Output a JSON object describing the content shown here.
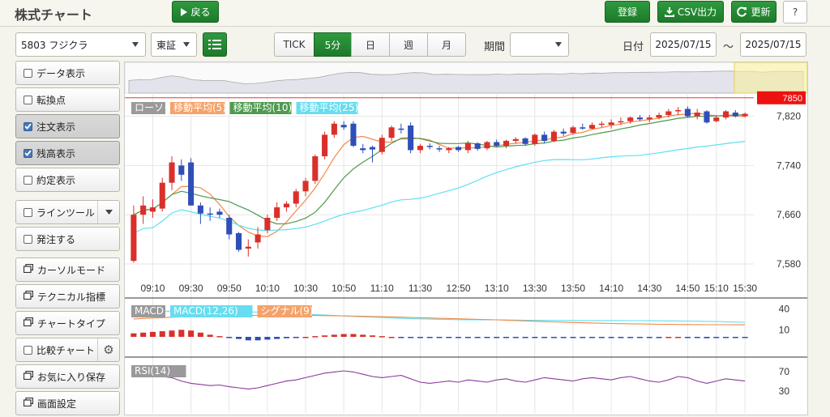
{
  "header": {
    "title": "株式チャート",
    "back_label": "戻る",
    "register_label": "登録",
    "csv_label": "CSV出力",
    "refresh_label": "更新",
    "help_label": "?"
  },
  "toolbar": {
    "stock": "5803 フジクラ",
    "market": "東証",
    "ranges": [
      "TICK",
      "5分",
      "日",
      "週",
      "月"
    ],
    "active_range": "5分",
    "period_label": "期間",
    "period_value": "",
    "date_label": "日付",
    "date_from": "2025/07/15",
    "date_sep": "～",
    "date_to": "2025/07/15"
  },
  "sidebar": {
    "items": [
      {
        "label": "データ表示",
        "type": "check",
        "checked": false
      },
      {
        "label": "転換点",
        "type": "check",
        "checked": false
      },
      {
        "label": "注文表示",
        "type": "check",
        "checked": true
      },
      {
        "label": "残高表示",
        "type": "check",
        "checked": true
      },
      {
        "label": "約定表示",
        "type": "check",
        "checked": false
      },
      {
        "label": "ラインツール",
        "type": "check-dropdown",
        "checked": false
      },
      {
        "label": "発注する",
        "type": "check",
        "checked": false
      },
      {
        "label": "カーソルモード",
        "type": "window"
      },
      {
        "label": "テクニカル指標",
        "type": "window"
      },
      {
        "label": "チャートタイプ",
        "type": "window"
      },
      {
        "label": "比較チャート",
        "type": "check-gear",
        "checked": false
      },
      {
        "label": "お気に入り保存",
        "type": "window"
      },
      {
        "label": "画面設定",
        "type": "window"
      }
    ]
  },
  "chart": {
    "main_legend": [
      {
        "label": "ローソク",
        "color": "#9a9a9a"
      },
      {
        "label": "移動平均(5)",
        "color": "#f5a26a"
      },
      {
        "label": "移動平均(10)",
        "color": "#4f9a4f"
      },
      {
        "label": "移動平均(25)",
        "color": "#66ddf0"
      }
    ],
    "price_marker": "7850",
    "y_ticks": [
      "7,820",
      "7,740",
      "7,660",
      "7,580"
    ],
    "x_ticks": [
      "09:10",
      "09:30",
      "09:50",
      "10:10",
      "10:30",
      "10:50",
      "11:10",
      "11:30",
      "12:50",
      "13:10",
      "13:30",
      "13:50",
      "14:10",
      "14:30",
      "14:50",
      "15:10",
      "15:30"
    ],
    "macd_legend": [
      {
        "label": "MACD",
        "color": "#9a9a9a"
      },
      {
        "label": "MACD(12,26)",
        "color": "#66ddf0"
      },
      {
        "label": "シグナル(9)",
        "color": "#f5a26a"
      }
    ],
    "macd_ticks": [
      "40",
      "10"
    ],
    "rsi_legend": [
      {
        "label": "RSI(14)",
        "color": "#9a9a9a"
      }
    ],
    "rsi_ticks": [
      "70",
      "30"
    ],
    "colors": {
      "up": "#d9302b",
      "down": "#2e4fb8",
      "ma5": "#f08a4b",
      "ma10": "#4f9a4f",
      "ma25": "#5ee0f2",
      "rsi": "#8a3a9a"
    }
  },
  "chart_data": {
    "type": "candlestick",
    "interval": "5分",
    "date": "2025/07/15",
    "candles": [
      {
        "o": 7585,
        "h": 7675,
        "l": 7582,
        "c": 7660
      },
      {
        "o": 7660,
        "h": 7690,
        "l": 7645,
        "c": 7675
      },
      {
        "o": 7665,
        "h": 7685,
        "l": 7655,
        "c": 7672
      },
      {
        "o": 7670,
        "h": 7720,
        "l": 7665,
        "c": 7712
      },
      {
        "o": 7712,
        "h": 7755,
        "l": 7700,
        "c": 7745
      },
      {
        "o": 7740,
        "h": 7750,
        "l": 7715,
        "c": 7725
      },
      {
        "o": 7745,
        "h": 7752,
        "l": 7675,
        "c": 7675
      },
      {
        "o": 7675,
        "h": 7680,
        "l": 7645,
        "c": 7662
      },
      {
        "o": 7662,
        "h": 7672,
        "l": 7650,
        "c": 7660
      },
      {
        "o": 7665,
        "h": 7670,
        "l": 7655,
        "c": 7660
      },
      {
        "o": 7655,
        "h": 7660,
        "l": 7620,
        "c": 7628
      },
      {
        "o": 7630,
        "h": 7632,
        "l": 7600,
        "c": 7603
      },
      {
        "o": 7605,
        "h": 7620,
        "l": 7592,
        "c": 7608
      },
      {
        "o": 7615,
        "h": 7640,
        "l": 7605,
        "c": 7628
      },
      {
        "o": 7635,
        "h": 7660,
        "l": 7630,
        "c": 7655
      },
      {
        "o": 7655,
        "h": 7680,
        "l": 7650,
        "c": 7672
      },
      {
        "o": 7672,
        "h": 7682,
        "l": 7665,
        "c": 7678
      },
      {
        "o": 7678,
        "h": 7702,
        "l": 7672,
        "c": 7698
      },
      {
        "o": 7698,
        "h": 7720,
        "l": 7690,
        "c": 7715
      },
      {
        "o": 7715,
        "h": 7758,
        "l": 7710,
        "c": 7755
      },
      {
        "o": 7755,
        "h": 7795,
        "l": 7750,
        "c": 7790
      },
      {
        "o": 7790,
        "h": 7812,
        "l": 7785,
        "c": 7808
      },
      {
        "o": 7806,
        "h": 7812,
        "l": 7798,
        "c": 7802
      },
      {
        "o": 7808,
        "h": 7812,
        "l": 7770,
        "c": 7772
      },
      {
        "o": 7768,
        "h": 7775,
        "l": 7760,
        "c": 7765
      },
      {
        "o": 7770,
        "h": 7772,
        "l": 7745,
        "c": 7766
      },
      {
        "o": 7762,
        "h": 7790,
        "l": 7758,
        "c": 7785
      },
      {
        "o": 7785,
        "h": 7805,
        "l": 7780,
        "c": 7802
      },
      {
        "o": 7800,
        "h": 7808,
        "l": 7792,
        "c": 7798
      },
      {
        "o": 7805,
        "h": 7810,
        "l": 7760,
        "c": 7765
      },
      {
        "o": 7765,
        "h": 7775,
        "l": 7760,
        "c": 7772
      },
      {
        "o": 7772,
        "h": 7776,
        "l": 7766,
        "c": 7770
      },
      {
        "o": 7768,
        "h": 7772,
        "l": 7762,
        "c": 7766
      },
      {
        "o": 7765,
        "h": 7770,
        "l": 7760,
        "c": 7768
      },
      {
        "o": 7770,
        "h": 7772,
        "l": 7762,
        "c": 7765
      },
      {
        "o": 7765,
        "h": 7780,
        "l": 7760,
        "c": 7776
      },
      {
        "o": 7776,
        "h": 7778,
        "l": 7764,
        "c": 7767
      },
      {
        "o": 7768,
        "h": 7780,
        "l": 7765,
        "c": 7778
      },
      {
        "o": 7778,
        "h": 7782,
        "l": 7770,
        "c": 7772
      },
      {
        "o": 7772,
        "h": 7782,
        "l": 7768,
        "c": 7780
      },
      {
        "o": 7780,
        "h": 7786,
        "l": 7776,
        "c": 7783
      },
      {
        "o": 7784,
        "h": 7786,
        "l": 7772,
        "c": 7775
      },
      {
        "o": 7775,
        "h": 7792,
        "l": 7772,
        "c": 7790
      },
      {
        "o": 7790,
        "h": 7795,
        "l": 7776,
        "c": 7780
      },
      {
        "o": 7780,
        "h": 7798,
        "l": 7778,
        "c": 7795
      },
      {
        "o": 7795,
        "h": 7800,
        "l": 7788,
        "c": 7792
      },
      {
        "o": 7793,
        "h": 7805,
        "l": 7790,
        "c": 7802
      },
      {
        "o": 7802,
        "h": 7808,
        "l": 7798,
        "c": 7800
      },
      {
        "o": 7800,
        "h": 7810,
        "l": 7798,
        "c": 7806
      },
      {
        "o": 7806,
        "h": 7812,
        "l": 7802,
        "c": 7808
      },
      {
        "o": 7806,
        "h": 7815,
        "l": 7800,
        "c": 7810
      },
      {
        "o": 7810,
        "h": 7818,
        "l": 7806,
        "c": 7812
      },
      {
        "o": 7812,
        "h": 7820,
        "l": 7808,
        "c": 7818
      },
      {
        "o": 7818,
        "h": 7822,
        "l": 7812,
        "c": 7815
      },
      {
        "o": 7815,
        "h": 7822,
        "l": 7810,
        "c": 7818
      },
      {
        "o": 7818,
        "h": 7826,
        "l": 7815,
        "c": 7822
      },
      {
        "o": 7822,
        "h": 7832,
        "l": 7818,
        "c": 7828
      },
      {
        "o": 7828,
        "h": 7835,
        "l": 7822,
        "c": 7830
      },
      {
        "o": 7832,
        "h": 7836,
        "l": 7818,
        "c": 7820
      },
      {
        "o": 7820,
        "h": 7832,
        "l": 7815,
        "c": 7826
      },
      {
        "o": 7828,
        "h": 7830,
        "l": 7808,
        "c": 7810
      },
      {
        "o": 7812,
        "h": 7822,
        "l": 7810,
        "c": 7818
      },
      {
        "o": 7818,
        "h": 7830,
        "l": 7815,
        "c": 7828
      },
      {
        "o": 7826,
        "h": 7830,
        "l": 7818,
        "c": 7820
      },
      {
        "o": 7820,
        "h": 7826,
        "l": 7818,
        "c": 7824
      }
    ],
    "macd_hist": [
      5,
      6,
      7,
      8,
      9,
      10,
      9,
      6,
      3,
      1,
      -1,
      -3,
      -5,
      -5,
      -4,
      -3,
      -2,
      -1,
      0,
      1,
      2,
      3,
      4,
      4,
      3,
      2,
      1,
      0,
      -1,
      -1,
      -1,
      -1,
      -1,
      -1,
      -1,
      -1,
      -1,
      -1,
      -1,
      -1,
      -1,
      -1,
      -1,
      -1,
      -1,
      -1,
      -1,
      -1,
      -1,
      -1,
      -1,
      -1,
      -1,
      -1,
      -1,
      -1,
      0,
      0,
      -1,
      -1,
      -2,
      -1,
      -1,
      -1,
      -1
    ],
    "y_range": [
      7555,
      7855
    ],
    "macd_range": [
      -15,
      45
    ],
    "rsi_range": [
      0,
      100
    ]
  }
}
